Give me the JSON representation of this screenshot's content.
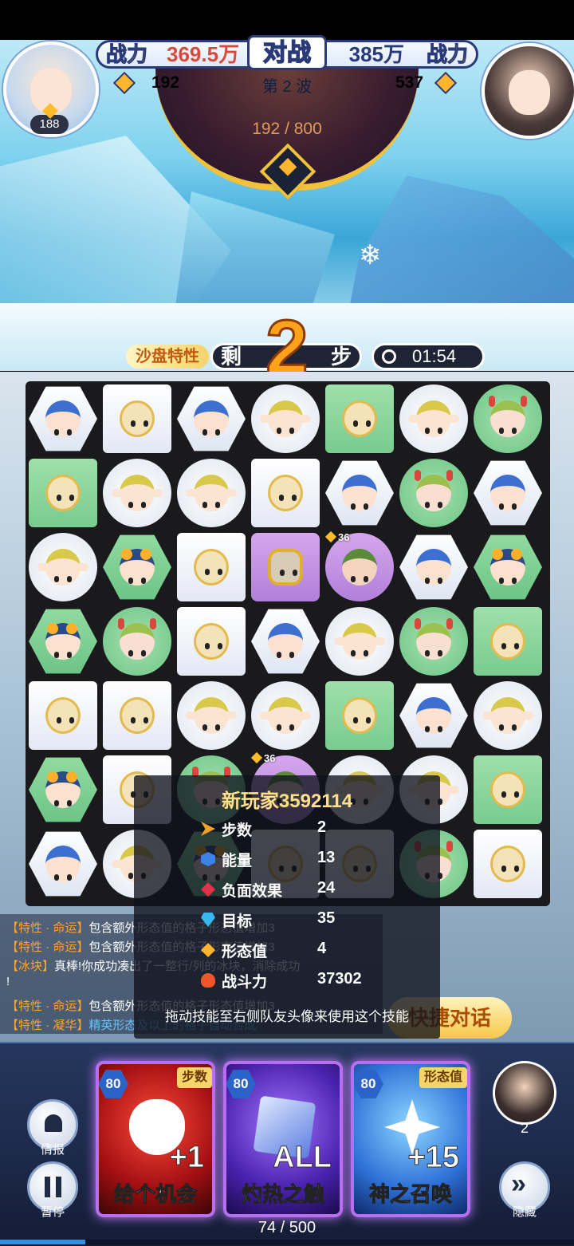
{
  "hud": {
    "left_power_label": "战力",
    "left_power_value": "369.5万",
    "vs_label": "对战",
    "right_power_value": "385万",
    "right_power_label": "战力",
    "left_score": "192",
    "wave": "第 2 波",
    "right_score": "537",
    "player_level": "188",
    "progress": "192 / 800"
  },
  "status": {
    "sand_trait": "沙盘特性",
    "remain_left": "剩",
    "steps_left": "2",
    "remain_right": "步",
    "timer": "01:54"
  },
  "board": {
    "badge_1": "36",
    "badge_2": "36"
  },
  "log": {
    "lines": [
      {
        "tag": "【特性 · 命运】",
        "text": "包含额外形态值的格子形态值增加3"
      },
      {
        "tag": "【特性 · 命运】",
        "text": "包含额外形态值的格子形态值增加3"
      },
      {
        "tag": "【冰块】",
        "text": "真棒!你成功凑出了一整行/列的冰块，消除成功"
      },
      {
        "tag": "",
        "text": "!"
      },
      {
        "tag": "【特性 · 命运】",
        "text": "包含额外形态值的格子形态值增加3"
      },
      {
        "tag": "【特性 · 凝华】",
        "text": "精英形态及以上的格子自动合成"
      }
    ]
  },
  "popup": {
    "title": "新玩家3592114",
    "stats": [
      {
        "label": "步数",
        "value": "2"
      },
      {
        "label": "能量",
        "value": "13"
      },
      {
        "label": "负面效果",
        "value": "24"
      },
      {
        "label": "目标",
        "value": "35"
      },
      {
        "label": "形态值",
        "value": "4"
      },
      {
        "label": "战斗力",
        "value": "37302"
      }
    ],
    "hint": "拖动技能至右侧队友头像来使用这个技能"
  },
  "quick_chat": "快捷对话",
  "buttons": {
    "intel": "情报",
    "pause": "暂停",
    "hide": "隐藏"
  },
  "cards": [
    {
      "level": "80",
      "tag": "步数",
      "big": "+1",
      "name": "给个机会"
    },
    {
      "level": "80",
      "tag": "",
      "big": "ALL",
      "name": "灼热之触"
    },
    {
      "level": "80",
      "tag": "形态值",
      "big": "+15",
      "name": "神之召唤"
    }
  ],
  "teammate_count": "2",
  "energy": "74 / 500",
  "energy_fraction": 0.148,
  "colors": {
    "accent": "#ffcc1a",
    "card_border": "#b76ef0"
  }
}
